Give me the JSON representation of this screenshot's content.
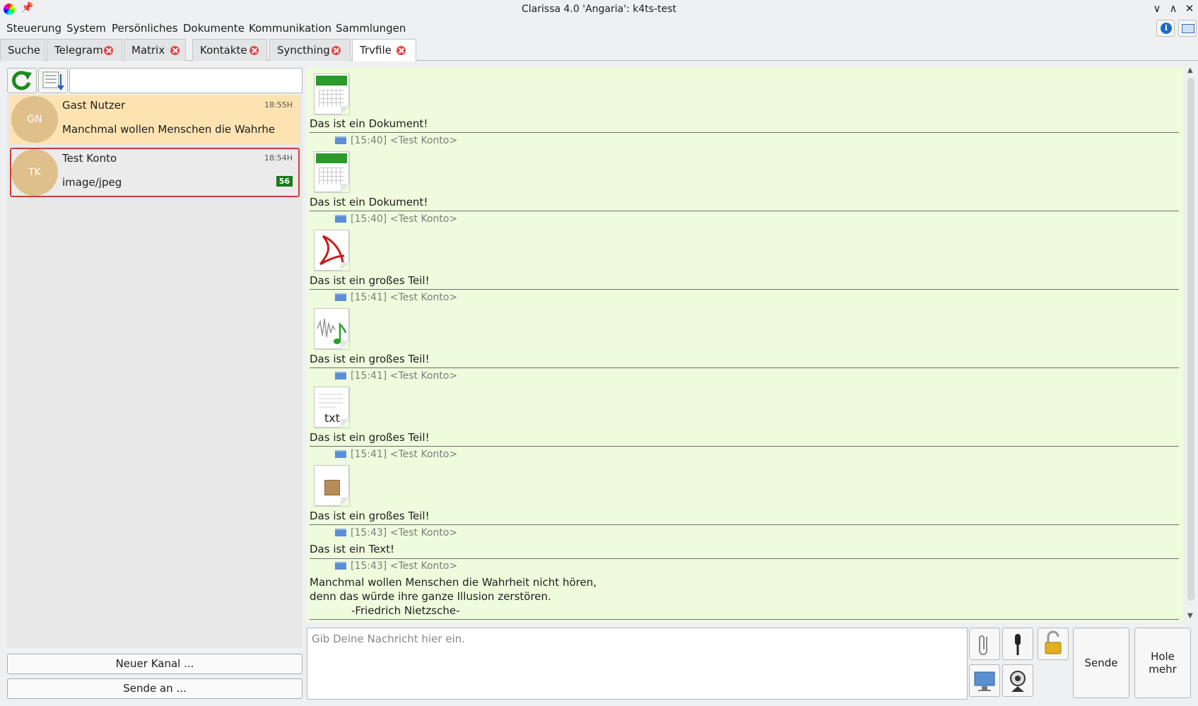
{
  "window": {
    "title": "Clarissa 4.0 'Angaria': k4ts-test",
    "controls": [
      "∨",
      "∧",
      "✕"
    ]
  },
  "menubar": {
    "items": [
      "Steuerung",
      "System",
      "Persönliches",
      "Dokumente",
      "Kommunikation",
      "Sammlungen"
    ]
  },
  "tabs": [
    {
      "label": "Suche",
      "closable": false
    },
    {
      "label": "Telegram",
      "closable": true
    },
    {
      "label": "Matrix",
      "closable": true
    },
    {
      "label": "Kontakte",
      "closable": true
    },
    {
      "label": "Syncthing",
      "closable": true
    },
    {
      "label": "Trvfile",
      "closable": true,
      "active": true
    }
  ],
  "chats": [
    {
      "initials": "GN",
      "name": "Gast Nutzer",
      "time": "18:55H",
      "preview": "Manchmal wollen Menschen die Wahrheit ni...",
      "bg": "#fde3b2"
    },
    {
      "initials": "TK",
      "name": "Test Konto",
      "time": "18:54H",
      "preview": "image/jpeg",
      "badge": "56",
      "bg": "#ebebeb",
      "border": "#d43a3a"
    }
  ],
  "left_buttons": {
    "new_channel": "Neuer Kanal ...",
    "send_to": "Sende an ..."
  },
  "messages": [
    {
      "header": "",
      "icon": "calendar-file-icon",
      "text": "Das ist ein Dokument!"
    },
    {
      "header": "[15:40] <Test Konto>",
      "icon": "calendar-file-icon",
      "text": "Das ist ein Dokument!"
    },
    {
      "header": "[15:40] <Test Konto>",
      "icon": "pdf-file-icon",
      "text": "Das ist ein großes Teil!"
    },
    {
      "header": "[15:41] <Test Konto>",
      "icon": "audio-file-icon",
      "text": "Das ist ein großes Teil!"
    },
    {
      "header": "[15:41] <Test Konto>",
      "icon": "txt-file-icon",
      "icon_label": "txt",
      "text": "Das ist ein großes Teil!"
    },
    {
      "header": "[15:41] <Test Konto>",
      "icon": "package-file-icon",
      "text": "Das ist ein großes Teil!"
    },
    {
      "header": "[15:43] <Test Konto>",
      "icon": "",
      "text": "Das ist ein Text!"
    },
    {
      "header": "[15:43] <Test Konto>",
      "icon": "",
      "lines": [
        "Manchmal wollen Menschen die Wahrheit nicht hören,",
        "denn das würde ihre ganze Illusion zerstören.",
        "-Friedrich Nietzsche-"
      ]
    }
  ],
  "composer": {
    "placeholder": "Gib Deine Nachricht hier ein.",
    "send_label": "Sende",
    "more_label_1": "Hole",
    "more_label_2": "mehr"
  },
  "colors": {
    "accent_green": "#1a7a1a",
    "message_bg": "#eefbdc",
    "close_red": "#e04a4a"
  }
}
